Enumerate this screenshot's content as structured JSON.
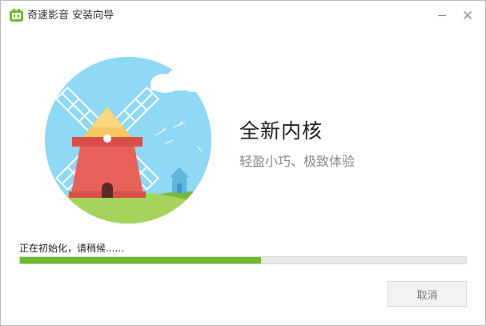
{
  "window": {
    "title": "奇速影音 安装向导",
    "logo_icon": "app-logo-icon",
    "minimize_icon": "minimize-icon",
    "close_icon": "close-icon"
  },
  "hero": {
    "headline": "全新内核",
    "subline": "轻盈小巧、极致体验",
    "illustration": "windmill-illustration"
  },
  "progress": {
    "status": "正在初始化，请稍候......",
    "percent": 54
  },
  "buttons": {
    "cancel_label": "取消"
  },
  "colors": {
    "accent": "#6db92f",
    "sky": "#8fd8f6",
    "grass": "#8cc63f",
    "windmill": "#e8625a"
  }
}
